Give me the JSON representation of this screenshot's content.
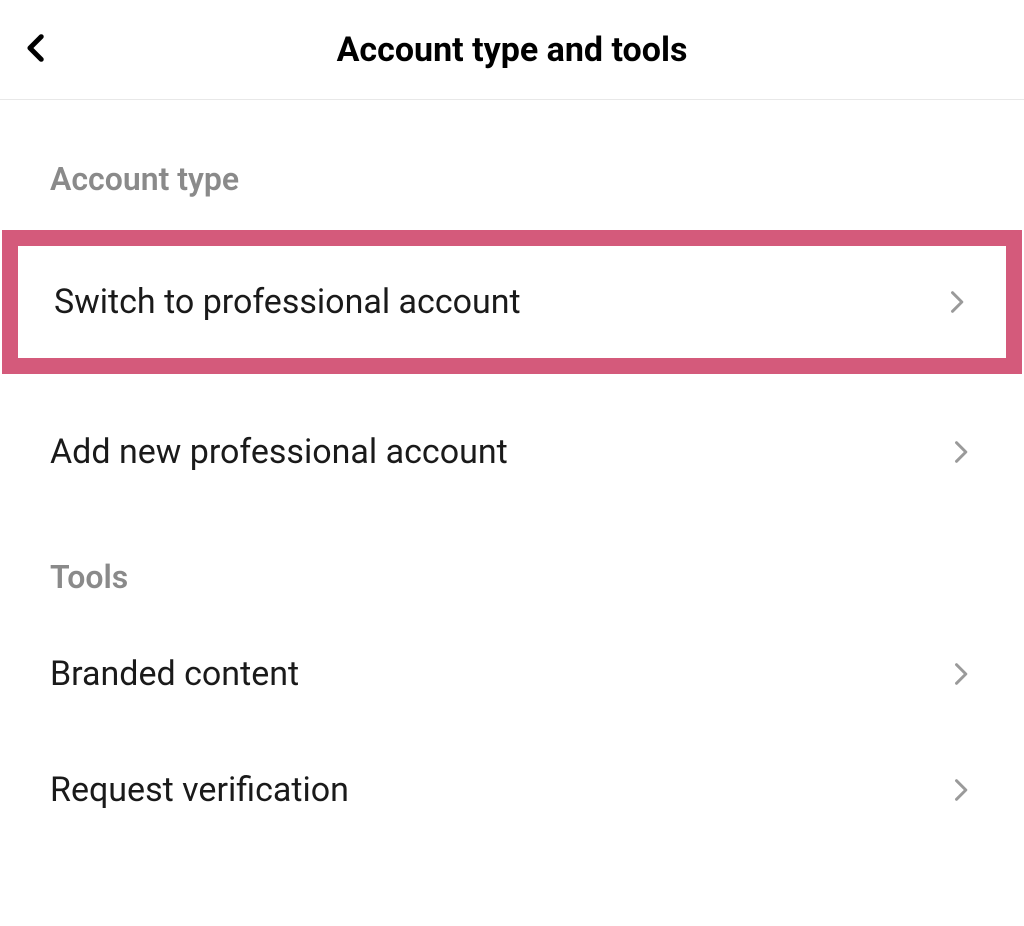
{
  "header": {
    "title": "Account type and tools"
  },
  "sections": {
    "account_type": {
      "header": "Account type",
      "items": {
        "switch_professional": "Switch to professional account",
        "add_professional": "Add new professional account"
      }
    },
    "tools": {
      "header": "Tools",
      "items": {
        "branded_content": "Branded content",
        "request_verification": "Request verification"
      }
    }
  }
}
